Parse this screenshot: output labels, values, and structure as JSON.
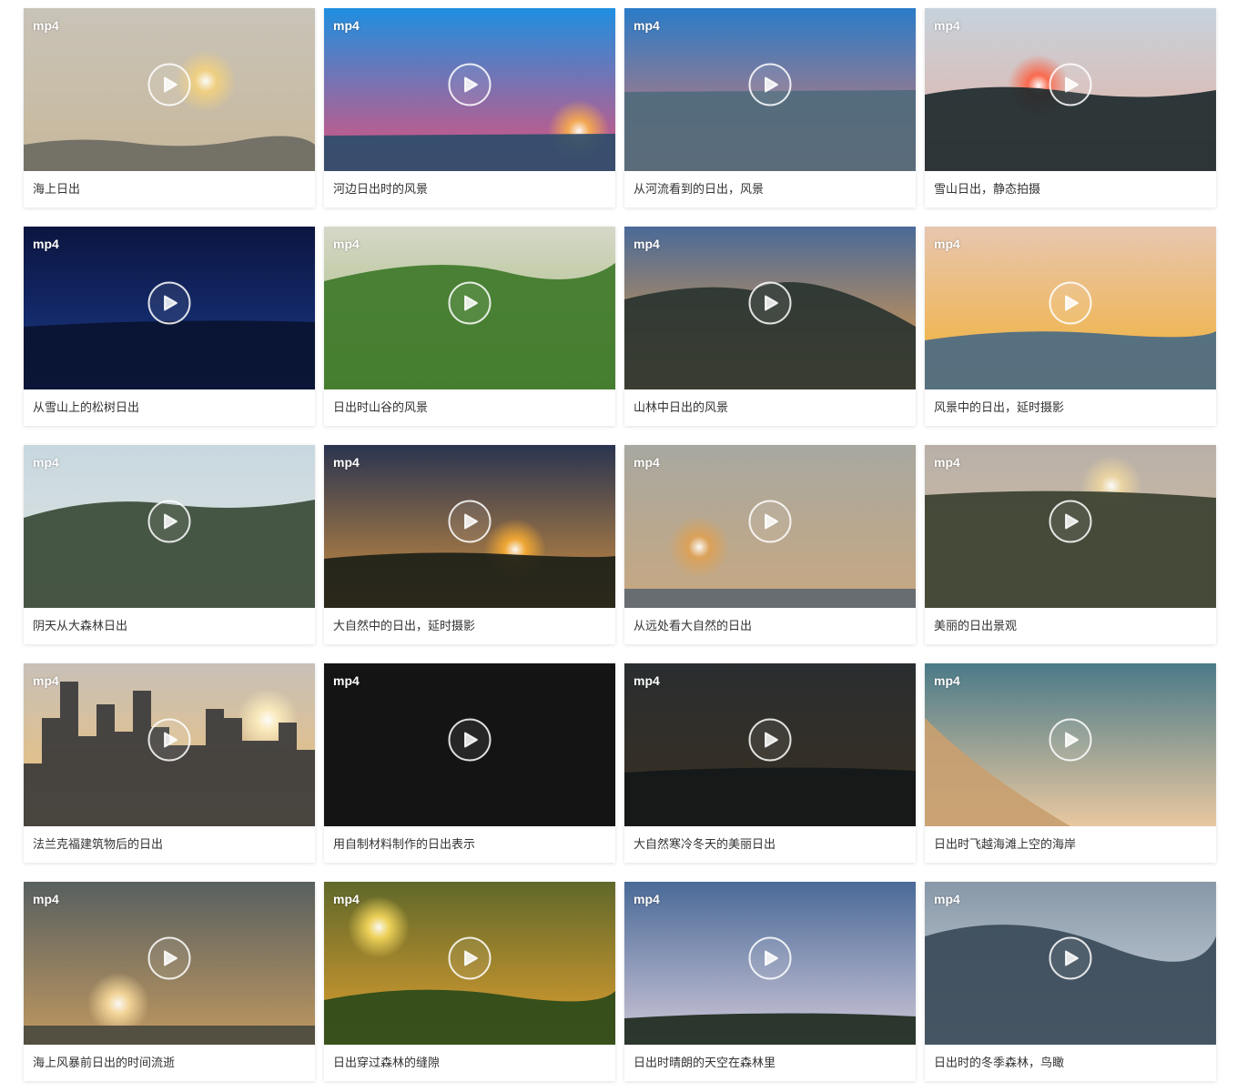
{
  "videos": [
    {
      "format": "mp4",
      "title": "海上日出",
      "sky": [
        "#c9c3b8",
        "#c7b89a"
      ],
      "land": "#6d6a63",
      "sun": "#f5d27a"
    },
    {
      "format": "mp4",
      "title": "河边日出时的风景",
      "sky": [
        "#1f8fe0",
        "#e2507a"
      ],
      "land": "#2d4d6b",
      "sun": "#ffb347"
    },
    {
      "format": "mp4",
      "title": "从河流看到的日出，风景",
      "sky": [
        "#2a7bc8",
        "#e07a6a"
      ],
      "land": "#4f6a7c",
      "sun": ""
    },
    {
      "format": "mp4",
      "title": "雪山日出，静态拍摄",
      "sky": [
        "#c6d2dc",
        "#e8b0a0"
      ],
      "land": "#1e2a2e",
      "sun": "#ff5a3a"
    },
    {
      "format": "mp4",
      "title": "从雪山上的松树日出",
      "sky": [
        "#0b1540",
        "#1a3a8a"
      ],
      "land": "#0a1230",
      "sun": ""
    },
    {
      "format": "mp4",
      "title": "日出时山谷的风景",
      "sky": [
        "#d6d8c8",
        "#9ab56a"
      ],
      "land": "#3f7a2a",
      "sun": ""
    },
    {
      "format": "mp4",
      "title": "山林中日出的风景",
      "sky": [
        "#4a6a98",
        "#f0a040"
      ],
      "land": "#2a3430",
      "sun": ""
    },
    {
      "format": "mp4",
      "title": "风景中的日出，延时摄影",
      "sky": [
        "#e8c6b0",
        "#f2b030"
      ],
      "land": "#4a6a84",
      "sun": ""
    },
    {
      "format": "mp4",
      "title": "阴天从大森林日出",
      "sky": [
        "#c8d8e0",
        "#e0e4e0"
      ],
      "land": "#3a4a36",
      "sun": ""
    },
    {
      "format": "mp4",
      "title": "大自然中的日出，延时摄影",
      "sky": [
        "#2a3450",
        "#d09040"
      ],
      "land": "#1c2018",
      "sun": "#ffb030"
    },
    {
      "format": "mp4",
      "title": "从远处看大自然的日出",
      "sky": [
        "#a8a8a0",
        "#c8a880"
      ],
      "land": "#606870",
      "sun": "#e0a050"
    },
    {
      "format": "mp4",
      "title": "美丽的日出景观",
      "sky": [
        "#b8b0a8",
        "#d8c0a0"
      ],
      "land": "#3a4030",
      "sun": "#f0d8a0"
    },
    {
      "format": "mp4",
      "title": "法兰克福建筑物后的日出",
      "sky": [
        "#c8c0b8",
        "#f0c070"
      ],
      "land": "#3a3a3a",
      "sun": "#fff0c0"
    },
    {
      "format": "mp4",
      "title": "用自制材料制作的日出表示",
      "sky": [
        "#141414",
        "#141414"
      ],
      "land": "#141414",
      "sun": ""
    },
    {
      "format": "mp4",
      "title": "大自然寒冷冬天的美丽日出",
      "sky": [
        "#2a2e30",
        "#3a3020"
      ],
      "land": "#141818",
      "sun": ""
    },
    {
      "format": "mp4",
      "title": "日出时飞越海滩上空的海岸",
      "sky": [
        "#4a7a88",
        "#e8c8a0"
      ],
      "land": "#c8a070",
      "sun": ""
    },
    {
      "format": "mp4",
      "title": "海上风暴前日出的时间流逝",
      "sky": [
        "#586060",
        "#c09860"
      ],
      "land": "#4a4a40",
      "sun": "#ffe0a0"
    },
    {
      "format": "mp4",
      "title": "日出穿过森林的缝隙",
      "sky": [
        "#60682a",
        "#e0a030"
      ],
      "land": "#2a4a1a",
      "sun": "#ffe060"
    },
    {
      "format": "mp4",
      "title": "日出时晴朗的天空在森林里",
      "sky": [
        "#4a6a98",
        "#d0c8d8"
      ],
      "land": "#1e2a20",
      "sun": ""
    },
    {
      "format": "mp4",
      "title": "日出时的冬季森林，鸟瞰",
      "sky": [
        "#8898a8",
        "#d0d8e0"
      ],
      "land": "#3a4a58",
      "sun": ""
    }
  ]
}
